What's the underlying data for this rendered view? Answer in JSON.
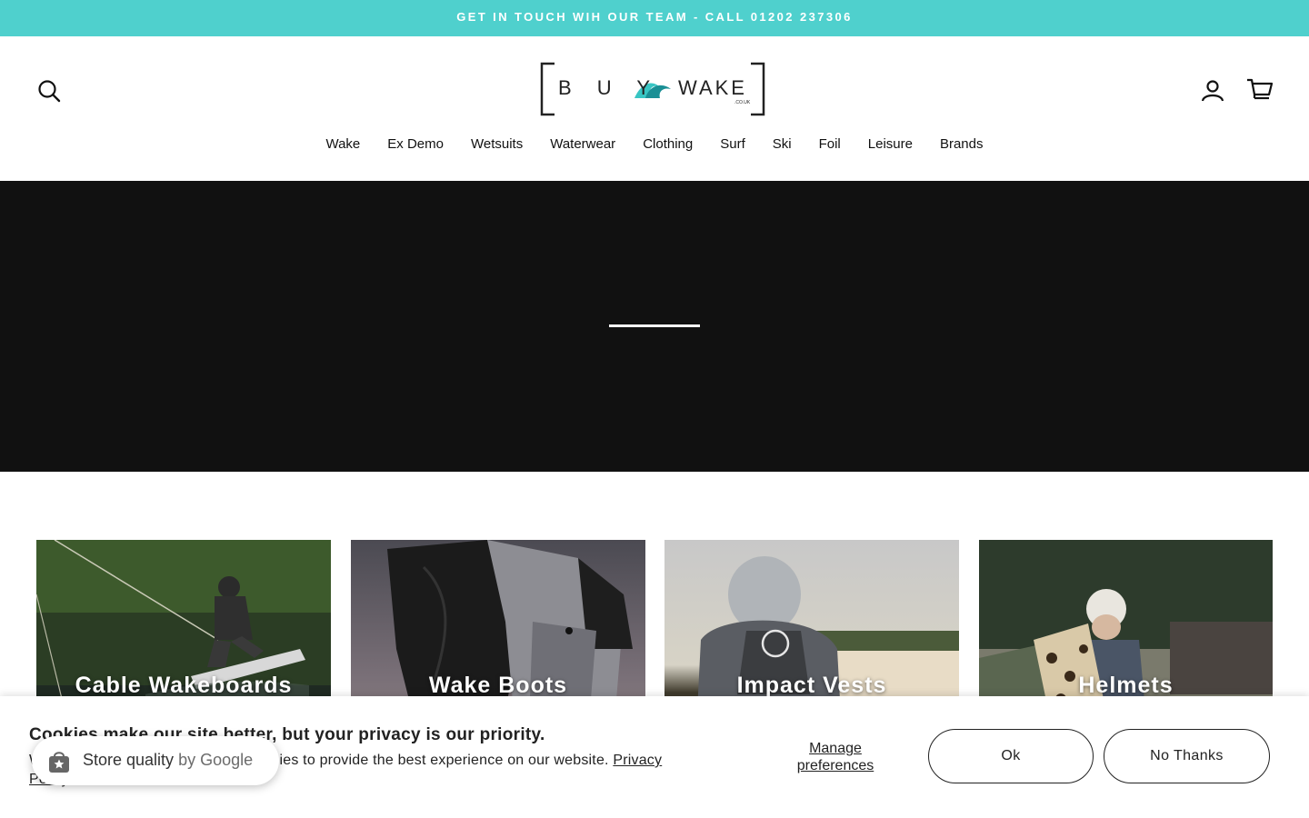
{
  "announcement": {
    "text": "GET IN TOUCH WIH OUR TEAM - CALL 01202 237306"
  },
  "header": {
    "logo": {
      "left": "B U Y",
      "right": "WAKE",
      "sub": ".CO.UK"
    },
    "icons": {
      "search": "search-icon",
      "account": "user-icon",
      "cart": "cart-icon"
    }
  },
  "nav": {
    "items": [
      {
        "label": "Wake"
      },
      {
        "label": "Ex Demo"
      },
      {
        "label": "Wetsuits"
      },
      {
        "label": "Waterwear"
      },
      {
        "label": "Clothing"
      },
      {
        "label": "Surf"
      },
      {
        "label": "Ski"
      },
      {
        "label": "Foil"
      },
      {
        "label": "Leisure"
      },
      {
        "label": "Brands"
      }
    ]
  },
  "collections": [
    {
      "title": "Cable Wakeboards"
    },
    {
      "title": "Wake Boots"
    },
    {
      "title": "Impact Vests"
    },
    {
      "title": "Helmets"
    }
  ],
  "cookie": {
    "heading": "Cookies make our site better, but your privacy is our priority.",
    "body": "We use cookies and similar technologies to provide the best experience on our website.",
    "privacy_link": "Privacy Policy",
    "manage_label": "Manage preferences",
    "ok_label": "Ok",
    "no_label": "No Thanks"
  },
  "badge": {
    "label": "Store quality",
    "by": "by Google"
  },
  "colors": {
    "accent": "#4fd0cd",
    "hero": "#111111"
  }
}
